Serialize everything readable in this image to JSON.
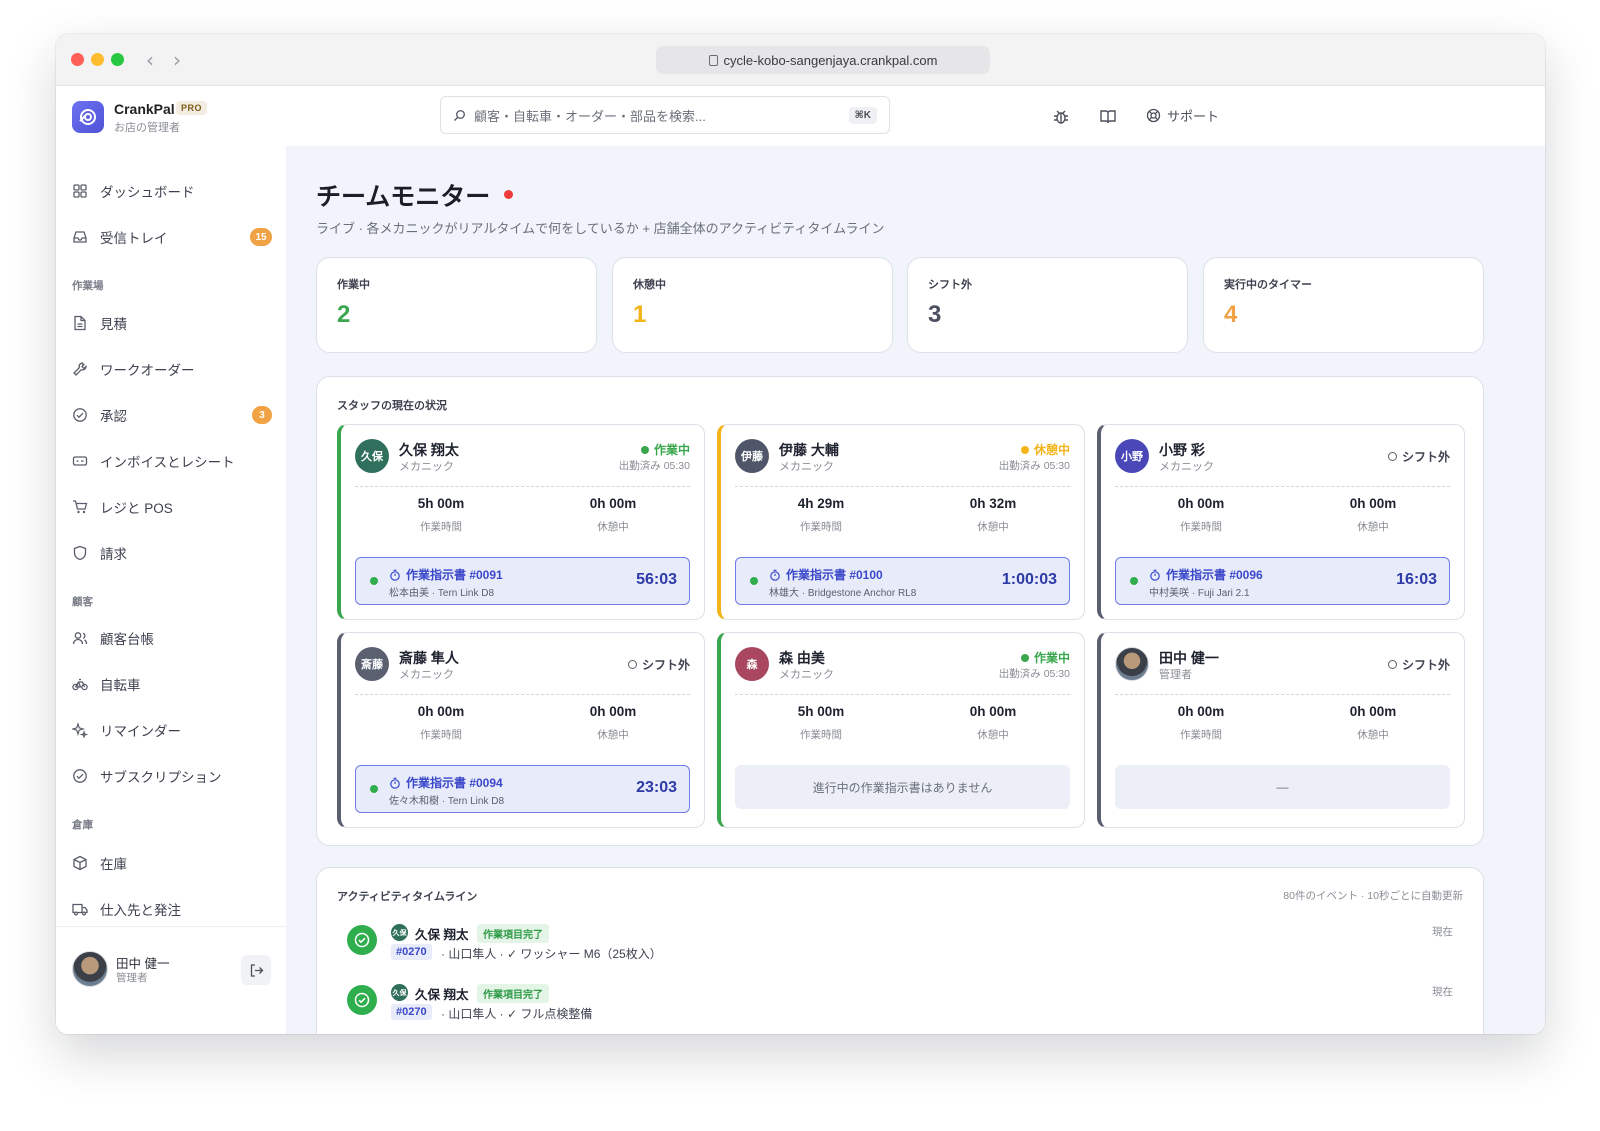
{
  "browser": {
    "url": "cycle-kobo-sangenjaya.crankpal.com"
  },
  "brand": {
    "name": "CrankPal",
    "badge": "PRO",
    "subtitle": "お店の管理者"
  },
  "search": {
    "placeholder": "顧客・自転車・オーダー・部品を検索...",
    "shortcut": "⌘K"
  },
  "header": {
    "support_label": "サポート"
  },
  "sidebar": {
    "top": [
      {
        "label": "ダッシュボード",
        "icon": "grid-icon"
      },
      {
        "label": "受信トレイ",
        "icon": "inbox-icon",
        "badge": "15"
      }
    ],
    "sections": [
      {
        "title": "作業場",
        "items": [
          {
            "label": "見積",
            "icon": "document-icon"
          },
          {
            "label": "ワークオーダー",
            "icon": "wrench-icon"
          },
          {
            "label": "承認",
            "icon": "check-circle-icon",
            "badge": "3"
          },
          {
            "label": "インボイスとレシート",
            "icon": "receipt-icon"
          },
          {
            "label": "レジと POS",
            "icon": "cart-icon"
          },
          {
            "label": "請求",
            "icon": "shield-icon"
          }
        ]
      },
      {
        "title": "顧客",
        "items": [
          {
            "label": "顧客台帳",
            "icon": "users-icon"
          },
          {
            "label": "自転車",
            "icon": "bike-icon"
          },
          {
            "label": "リマインダー",
            "icon": "sparkle-icon"
          },
          {
            "label": "サブスクリプション",
            "icon": "check-circle-icon"
          }
        ]
      },
      {
        "title": "倉庫",
        "items": [
          {
            "label": "在庫",
            "icon": "box-icon"
          },
          {
            "label": "仕入先と発注",
            "icon": "truck-icon"
          }
        ]
      }
    ],
    "user": {
      "name": "田中 健一",
      "role": "管理者"
    }
  },
  "page": {
    "title": "チームモニター",
    "subtitle": "ライブ · 各メカニックがリアルタイムで何をしているか + 店舗全体のアクティビティタイムライン"
  },
  "kpis": [
    {
      "label": "作業中",
      "value": "2",
      "color": "#3aa64e"
    },
    {
      "label": "休憩中",
      "value": "1",
      "color": "#f2b419"
    },
    {
      "label": "シフト外",
      "value": "3",
      "color": "#4b5060"
    },
    {
      "label": "実行中のタイマー",
      "value": "4",
      "color": "#f0a244"
    }
  ],
  "staff_panel": {
    "title": "スタッフの現在の状況",
    "metric_labels": {
      "work": "作業時間",
      "break": "休憩中"
    },
    "staff": [
      {
        "initials": "久保",
        "name": "久保 翔太",
        "role": "メカニック",
        "status": "作業中",
        "status_kind": "working",
        "clock_in": "出勤済み 05:30",
        "work_time": "5h 00m",
        "break_time": "0h 00m",
        "avatar_color": "#2f6f5b",
        "work_order": {
          "title": "作業指示書 #0091",
          "detail": "松本由美 · Tern Link D8",
          "timer": "56:03"
        }
      },
      {
        "initials": "伊藤",
        "name": "伊藤 大輔",
        "role": "メカニック",
        "status": "休憩中",
        "status_kind": "break",
        "clock_in": "出勤済み 05:30",
        "work_time": "4h 29m",
        "break_time": "0h 32m",
        "avatar_color": "#4f5668",
        "work_order": {
          "title": "作業指示書 #0100",
          "detail": "林雄大 · Bridgestone Anchor RL8",
          "timer": "1:00:03"
        }
      },
      {
        "initials": "小野",
        "name": "小野 彩",
        "role": "メカニック",
        "status": "シフト外",
        "status_kind": "off",
        "clock_in": "",
        "work_time": "0h 00m",
        "break_time": "0h 00m",
        "avatar_color": "#4a47b8",
        "work_order": {
          "title": "作業指示書 #0096",
          "detail": "中村美咲 · Fuji Jari 2.1",
          "timer": "16:03"
        }
      },
      {
        "initials": "斎藤",
        "name": "斎藤 隼人",
        "role": "メカニック",
        "status": "シフト外",
        "status_kind": "off",
        "clock_in": "",
        "work_time": "0h 00m",
        "break_time": "0h 00m",
        "avatar_color": "#5a6070",
        "work_order": {
          "title": "作業指示書 #0094",
          "detail": "佐々木和樹 · Tern Link D8",
          "timer": "23:03"
        }
      },
      {
        "initials": "森",
        "name": "森 由美",
        "role": "メカニック",
        "status": "作業中",
        "status_kind": "working",
        "clock_in": "出勤済み 05:30",
        "work_time": "5h 00m",
        "break_time": "0h 00m",
        "avatar_color": "#a8475f",
        "empty_text": "進行中の作業指示書はありません"
      },
      {
        "initials": "",
        "name": "田中 健一",
        "role": "管理者",
        "status": "シフト外",
        "status_kind": "off",
        "clock_in": "",
        "work_time": "0h 00m",
        "break_time": "0h 00m",
        "avatar_color": "photo",
        "empty_text": "—"
      }
    ]
  },
  "timeline": {
    "title": "アクティビティタイムライン",
    "meta": "80件のイベント · 10秒ごとに自動更新",
    "events": [
      {
        "avatar": "久保",
        "name": "久保 翔太",
        "tag": "作業項目完了",
        "ref": "#0270",
        "desc": "· 山口隼人 · ✓ ワッシャー M6（25枚入）",
        "time": "現在"
      },
      {
        "avatar": "久保",
        "name": "久保 翔太",
        "tag": "作業項目完了",
        "ref": "#0270",
        "desc": "· 山口隼人 · ✓ フル点検整備",
        "time": "現在"
      }
    ]
  },
  "colors": {
    "working": "#3aa64e",
    "break": "#f2b419",
    "off": "#5a6070",
    "accent": "#5b5fe0"
  }
}
